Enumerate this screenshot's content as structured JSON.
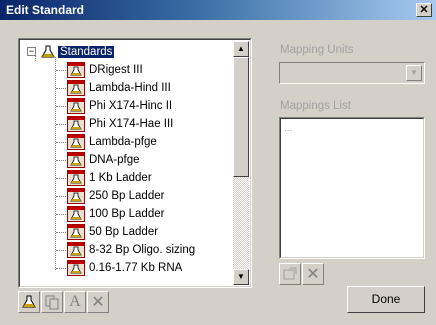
{
  "window": {
    "title": "Edit Standard",
    "close_glyph": "✕"
  },
  "tree": {
    "root_label": "Standards",
    "root_expander": "−",
    "root_icon": "flask-icon",
    "leaf_icon": "standard-ladder-icon",
    "items": [
      "DRigest III",
      "Lambda-Hind III",
      "Phi X174-Hinc II",
      "Phi X174-Hae III",
      "Lambda-pfge",
      "DNA-pfge",
      "1 Kb Ladder",
      "250 Bp Ladder",
      "100 Bp Ladder",
      "50 Bp Ladder",
      "8-32 Bp Oligo. sizing",
      "0.16-1.77 Kb RNA"
    ],
    "scroll_up_glyph": "▲",
    "scroll_down_glyph": "▼"
  },
  "toolbar": {
    "buttons": [
      {
        "name": "new-standard-button",
        "icon": "flask-icon",
        "enabled": true
      },
      {
        "name": "copy-button",
        "icon": "copy-icon",
        "enabled": false
      },
      {
        "name": "rename-button",
        "icon": "text-a-icon",
        "glyph": "A",
        "enabled": false
      },
      {
        "name": "delete-button",
        "icon": "delete-x-icon",
        "glyph": "✕",
        "enabled": false
      }
    ]
  },
  "mapping": {
    "units_label": "Mapping Units",
    "units_value": "",
    "combo_glyph": "▼",
    "list_label": "Mappings List",
    "list_placeholder": "...",
    "buttons": [
      {
        "name": "add-mapping-button",
        "icon": "edit-mapping-icon",
        "enabled": false
      },
      {
        "name": "delete-mapping-button",
        "icon": "delete-x-icon",
        "glyph": "✕",
        "enabled": false
      }
    ]
  },
  "done_label": "Done",
  "colors": {
    "selection": "#0a246a",
    "face": "#d4d0c8",
    "disabled_text": "#a0a0a0"
  }
}
